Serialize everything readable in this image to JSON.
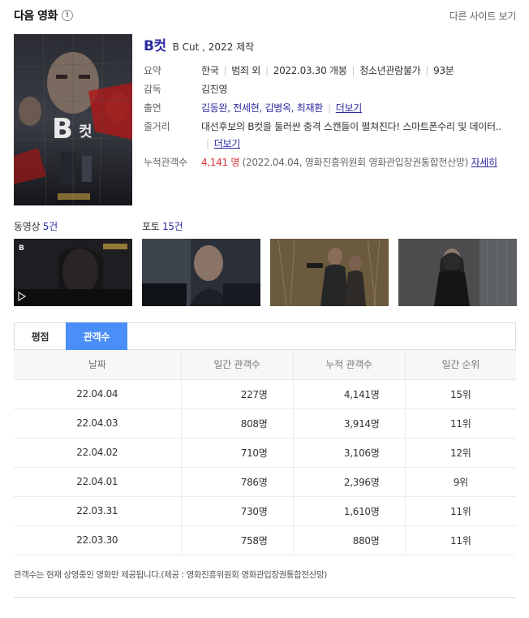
{
  "header": {
    "title": "다음 영화",
    "info_symbol": "!",
    "other_sites": "다른 사이트 보기"
  },
  "movie": {
    "title": "B컷",
    "subtitle": "B Cut , 2022 제작",
    "summary_label": "요약",
    "summary": {
      "country": "한국",
      "genre": "범죄 외",
      "release": "2022.03.30 개봉",
      "rating": "청소년관람불가",
      "runtime": "93분"
    },
    "director_label": "감독",
    "director": "김진영",
    "cast_label": "출연",
    "cast": "김동완, 전세현, 김병옥, 최재환",
    "cast_more": "더보기",
    "plot_label": "줄거리",
    "plot": "대선후보의 B컷을 둘러싼 충격 스캔들이 펼쳐진다! 스마트폰수리 및 데이터..",
    "plot_more": "더보기",
    "audience_label": "누적관객수",
    "audience_count": "4,141 명",
    "audience_source": "(2022.04.04, 영화진흥위원회 영화관입장권통합전산망)",
    "audience_detail": "자세히"
  },
  "media": {
    "video_label": "동영상",
    "video_count": "5건",
    "photo_label": "포토",
    "photo_count": "15건"
  },
  "tabs": [
    {
      "label": "평점",
      "active": false
    },
    {
      "label": "관객수",
      "active": true
    }
  ],
  "table": {
    "headers": [
      "날짜",
      "일간 관객수",
      "누적 관객수",
      "일간 순위"
    ],
    "rows": [
      [
        "22.04.04",
        "227명",
        "4,141명",
        "15위"
      ],
      [
        "22.04.03",
        "808명",
        "3,914명",
        "11위"
      ],
      [
        "22.04.02",
        "710명",
        "3,106명",
        "12위"
      ],
      [
        "22.04.01",
        "786명",
        "2,396명",
        "9위"
      ],
      [
        "22.03.31",
        "730명",
        "1,610명",
        "11위"
      ],
      [
        "22.03.30",
        "758명",
        "880명",
        "11위"
      ]
    ]
  },
  "note": "관객수는 현재 상영중인 영화만 제공됩니다.(제공 : 영화진흥위원회 영화관입장권통합전산망)"
}
